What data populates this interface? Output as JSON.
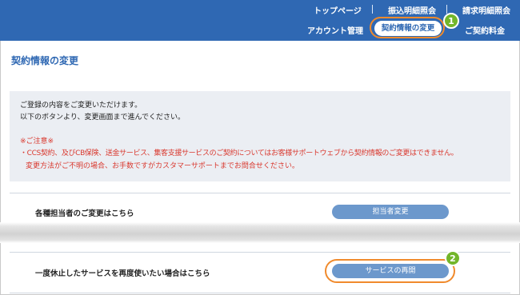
{
  "header": {
    "top_links": [
      "トップページ",
      "振込明細照会",
      "請求明細照会"
    ],
    "bottom_links": [
      "アカウント管理",
      "契約情報の変更",
      "ご契約料金"
    ],
    "active_tab": "契約情報の変更"
  },
  "steps": [
    "1",
    "2"
  ],
  "page": {
    "title": "契約情報の変更",
    "intro_line1": "ご登録の内容をご変更いただけます。",
    "intro_line2": "以下のボタンより、変更画面まで進んでください。",
    "notice_heading": "※ご注意※",
    "notice_line1": "・CCS契約、及びCB保険、送金サービス、集客支援サービスのご契約についてはお客様サポートウェブから契約情報のご変更はできません。",
    "notice_line2": "変更方法がご不明の場合、お手数ですがカスタマーサポートまでお問合せください。"
  },
  "rows": [
    {
      "label": "各種担当者のご変更はこちら",
      "button": "担当者変更"
    },
    {
      "label": "一度休止したサービスを再度使いたい場合はこちら",
      "button": "サービスの再開"
    }
  ],
  "colors": {
    "header_bg": "#2f68b3",
    "accent_orange": "#f08a2c",
    "step_badge": "#73b62a",
    "button_bg": "#6c98cc",
    "notice_red": "#d9382e"
  }
}
